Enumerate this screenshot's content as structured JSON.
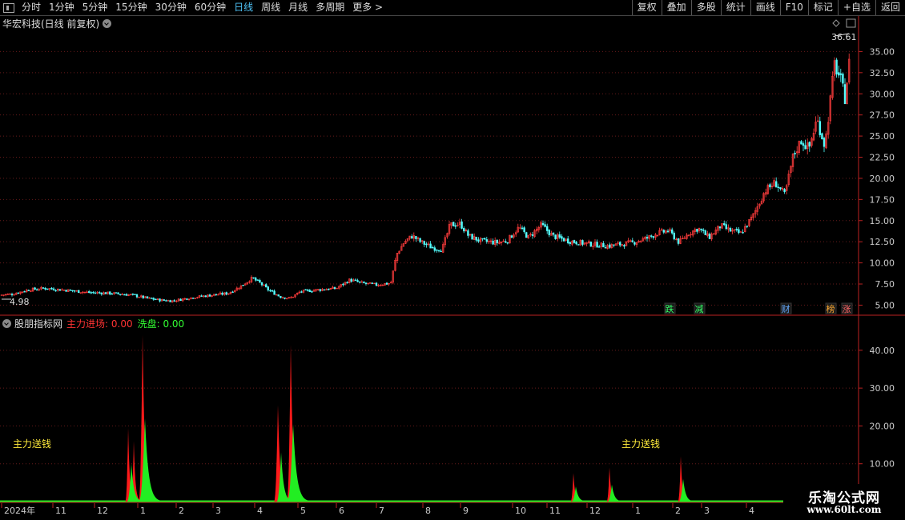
{
  "toolbar": {
    "periods": [
      "分时",
      "1分钟",
      "5分钟",
      "15分钟",
      "30分钟",
      "60分钟",
      "日线",
      "周线",
      "月线",
      "多周期",
      "更多 >"
    ],
    "active_period": "日线",
    "right_buttons": [
      "复权",
      "叠加",
      "多股",
      "统计",
      "画线",
      "F10",
      "标记",
      "+自选",
      "返回"
    ]
  },
  "main_chart": {
    "title": "华宏科技(日线 前复权)",
    "high_label": "36.61",
    "low_label": "4.98",
    "events": [
      {
        "text": "跌",
        "color": "#33ff66"
      },
      {
        "text": "减",
        "color": "#33ff66"
      },
      {
        "text": "财",
        "color": "#66aaff"
      },
      {
        "text": "榜",
        "color": "#ffaa33"
      },
      {
        "text": "涨",
        "color": "#ff6666"
      }
    ]
  },
  "indicator": {
    "name": "股朋指标网",
    "line1_label": "主力进场: 0.00",
    "line2_label": "洗盘: 0.00",
    "annotations": [
      "主力送钱",
      "主力送钱"
    ]
  },
  "watermark": {
    "line1": "乐淘公式网",
    "line2": "www.60lt.com"
  },
  "chart_data": [
    {
      "type": "candlestick",
      "title": "华宏科技(日线 前复权)",
      "y_ticks": [
        "35.00",
        "32.50",
        "30.00",
        "27.50",
        "25.00",
        "22.50",
        "20.00",
        "17.50",
        "15.00",
        "12.50",
        "10.00",
        "7.50",
        "5.00"
      ],
      "ylim": [
        4.0,
        37.5
      ],
      "x_month_labels": [
        "2024年",
        "11",
        "12",
        "1",
        "2",
        "3",
        "4",
        "5",
        "6",
        "7",
        "8",
        "9",
        "10",
        "11",
        "12",
        "1",
        "2",
        "3",
        "4"
      ],
      "close_path": [
        [
          0,
          6.2
        ],
        [
          15,
          6.3
        ],
        [
          35,
          6.8
        ],
        [
          55,
          7.0
        ],
        [
          80,
          6.8
        ],
        [
          110,
          6.5
        ],
        [
          140,
          6.4
        ],
        [
          165,
          6.2
        ],
        [
          185,
          5.8
        ],
        [
          200,
          5.6
        ],
        [
          215,
          5.5
        ],
        [
          240,
          5.9
        ],
        [
          265,
          6.2
        ],
        [
          285,
          6.4
        ],
        [
          300,
          7.2
        ],
        [
          315,
          8.2
        ],
        [
          325,
          7.6
        ],
        [
          335,
          6.8
        ],
        [
          350,
          6.0
        ],
        [
          362,
          5.8
        ],
        [
          375,
          6.6
        ],
        [
          395,
          6.8
        ],
        [
          420,
          7.0
        ],
        [
          437,
          8.0
        ],
        [
          452,
          7.6
        ],
        [
          470,
          7.4
        ],
        [
          488,
          7.6
        ],
        [
          495,
          11.0
        ],
        [
          505,
          12.5
        ],
        [
          515,
          13.2
        ],
        [
          525,
          12.5
        ],
        [
          540,
          11.8
        ],
        [
          552,
          11.6
        ],
        [
          562,
          14.5
        ],
        [
          575,
          14.6
        ],
        [
          585,
          13.2
        ],
        [
          600,
          12.6
        ],
        [
          620,
          12.4
        ],
        [
          633,
          12.6
        ],
        [
          648,
          14.2
        ],
        [
          660,
          13.0
        ],
        [
          676,
          14.5
        ],
        [
          690,
          13.2
        ],
        [
          710,
          12.6
        ],
        [
          730,
          12.3
        ],
        [
          760,
          12.0
        ],
        [
          790,
          12.4
        ],
        [
          810,
          13.0
        ],
        [
          820,
          13.5
        ],
        [
          835,
          13.8
        ],
        [
          848,
          12.4
        ],
        [
          860,
          13.5
        ],
        [
          872,
          14.1
        ],
        [
          885,
          13.0
        ],
        [
          900,
          14.4
        ],
        [
          912,
          13.8
        ],
        [
          925,
          13.5
        ],
        [
          940,
          15.5
        ],
        [
          955,
          18.5
        ],
        [
          968,
          19.5
        ],
        [
          980,
          18.0
        ],
        [
          990,
          22.5
        ],
        [
          1000,
          24.5
        ],
        [
          1010,
          23.5
        ],
        [
          1020,
          27.0
        ],
        [
          1030,
          23.8
        ],
        [
          1042,
          33.5
        ],
        [
          1050,
          31.5
        ],
        [
          1055,
          29.5
        ],
        [
          1062,
          35.0
        ]
      ],
      "high": 36.61,
      "low": 4.98
    },
    {
      "type": "area",
      "title": "股朋指标网",
      "y_ticks": [
        "40.00",
        "30.00",
        "20.00",
        "10.00"
      ],
      "ylim": [
        0,
        48
      ],
      "series": [
        {
          "name": "主力进场",
          "color": "#ff1a1a",
          "peaks": [
            [
              160,
              19.5
            ],
            [
              167,
              16
            ],
            [
              178,
              44
            ],
            [
              347,
              25.5
            ],
            [
              363,
              41.5
            ],
            [
              716,
              7.5
            ],
            [
              761,
              9
            ],
            [
              850,
              12
            ]
          ]
        },
        {
          "name": "洗盘",
          "color": "#22ee22",
          "peaks": [
            [
              164,
              10
            ],
            [
              181,
              22
            ],
            [
              351,
              13
            ],
            [
              366,
              20.5
            ],
            [
              719,
              4
            ],
            [
              764,
              4.5
            ],
            [
              853,
              6
            ]
          ]
        }
      ]
    }
  ]
}
